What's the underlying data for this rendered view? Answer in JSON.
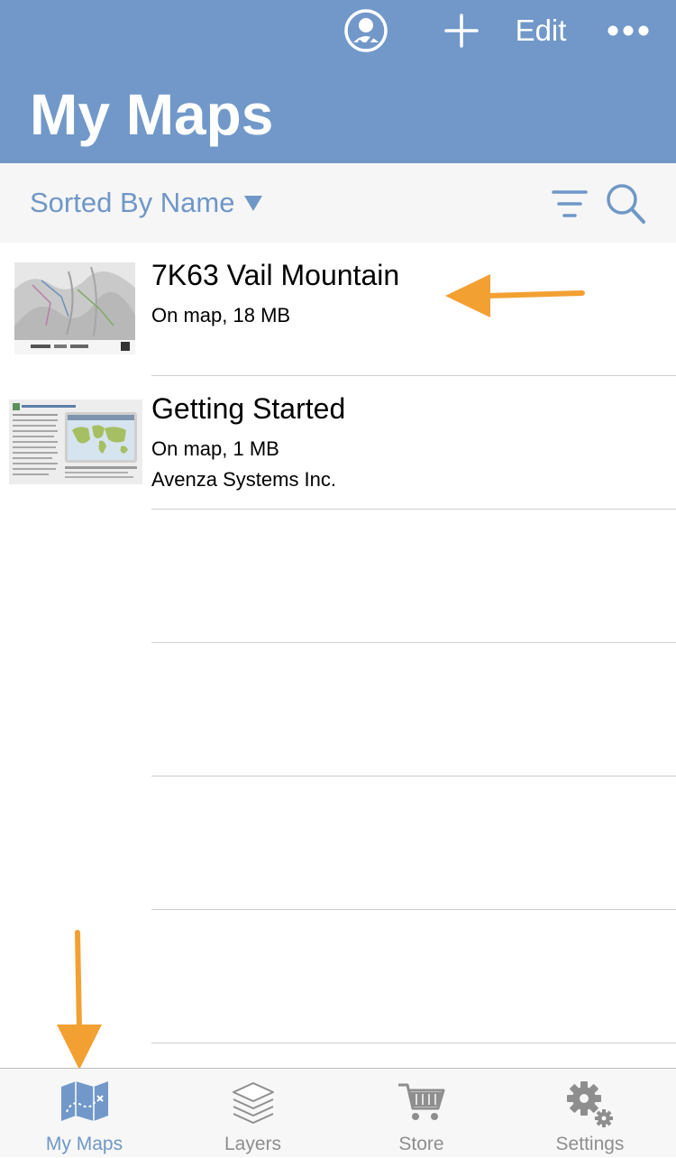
{
  "header": {
    "title": "My Maps",
    "edit_label": "Edit",
    "icons": [
      "profile-icon",
      "plus-icon",
      "more-icon"
    ],
    "background_color": "#7198c9"
  },
  "sortbar": {
    "sort_label": "Sorted By Name",
    "icons": [
      "caret-down-icon",
      "filter-icon",
      "search-icon"
    ],
    "accent_color": "#6f97c7"
  },
  "maps": [
    {
      "title": "7K63 Vail Mountain",
      "status": "On map, 18 MB"
    },
    {
      "title": "Getting Started",
      "status": "On map, 1 MB",
      "publisher": "Avenza Systems Inc."
    }
  ],
  "annotations": {
    "arrow_color": "#f3a033"
  },
  "tabbar": {
    "active_tab": "My Maps",
    "tabs": [
      {
        "label": "My Maps",
        "icon": "map-icon"
      },
      {
        "label": "Layers",
        "icon": "layers-icon"
      },
      {
        "label": "Store",
        "icon": "cart-icon"
      },
      {
        "label": "Settings",
        "icon": "gear-icon"
      }
    ]
  }
}
